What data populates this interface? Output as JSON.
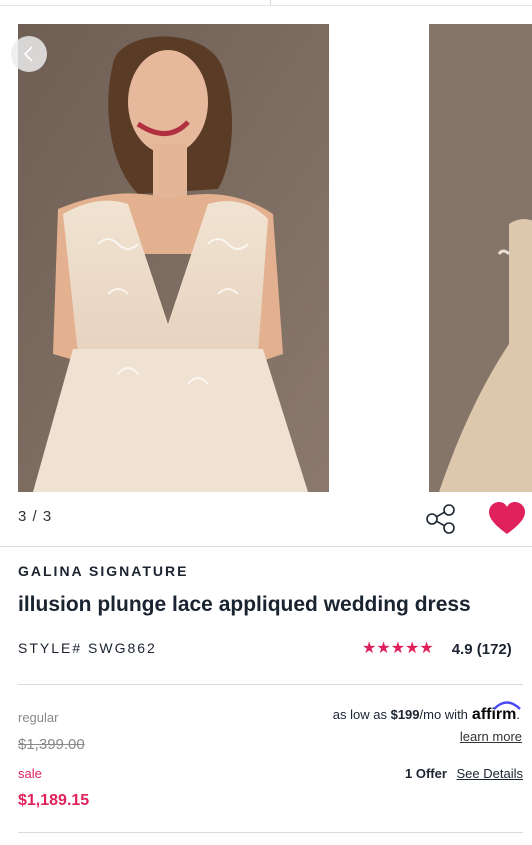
{
  "gallery": {
    "counter": "3 / 3",
    "current_index": 3,
    "total_images": 3
  },
  "product": {
    "brand": "GALINA SIGNATURE",
    "title": "illusion plunge lace appliqued wedding dress",
    "style": "STYLE# SWG862",
    "rating": {
      "stars": 5,
      "text": "4.9 (172)",
      "star_color": "#e0225c"
    }
  },
  "pricing": {
    "regular_label": "regular",
    "regular_price": "$1,399.00",
    "sale_label": "sale",
    "sale_price": "$1,189.15",
    "sale_color": "#e0225c"
  },
  "financing": {
    "prefix": "as low as",
    "amount": "$199",
    "suffix": "/mo with",
    "provider": "affirm",
    "period": ".",
    "learn_more": "learn more"
  },
  "offers": {
    "count_label": "1 Offer",
    "details_link": "See Details"
  },
  "colors": {
    "accent": "#e0225c",
    "text": "#1c2431"
  }
}
